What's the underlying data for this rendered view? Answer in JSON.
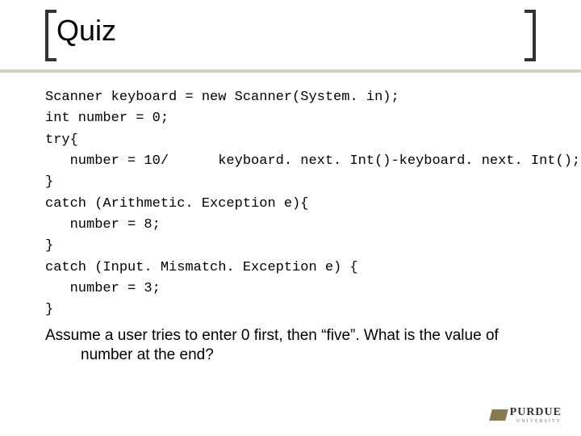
{
  "slide": {
    "title": "Quiz",
    "code_lines": [
      "Scanner keyboard = new Scanner(System. in);",
      "int number = 0;",
      "try{",
      "   number = 10/      keyboard. next. Int()-keyboard. next. Int();",
      "}",
      "catch (Arithmetic. Exception e){",
      "   number = 8;",
      "}",
      "catch (Input. Mismatch. Exception e) {",
      "   number = 3;",
      "}"
    ],
    "question_line1": "Assume a user tries to enter 0 first, then “five”. What is the value of",
    "question_line2": "number at the end?"
  },
  "footer": {
    "brand": "PURDUE",
    "subbrand": "UNIVERSITY"
  }
}
